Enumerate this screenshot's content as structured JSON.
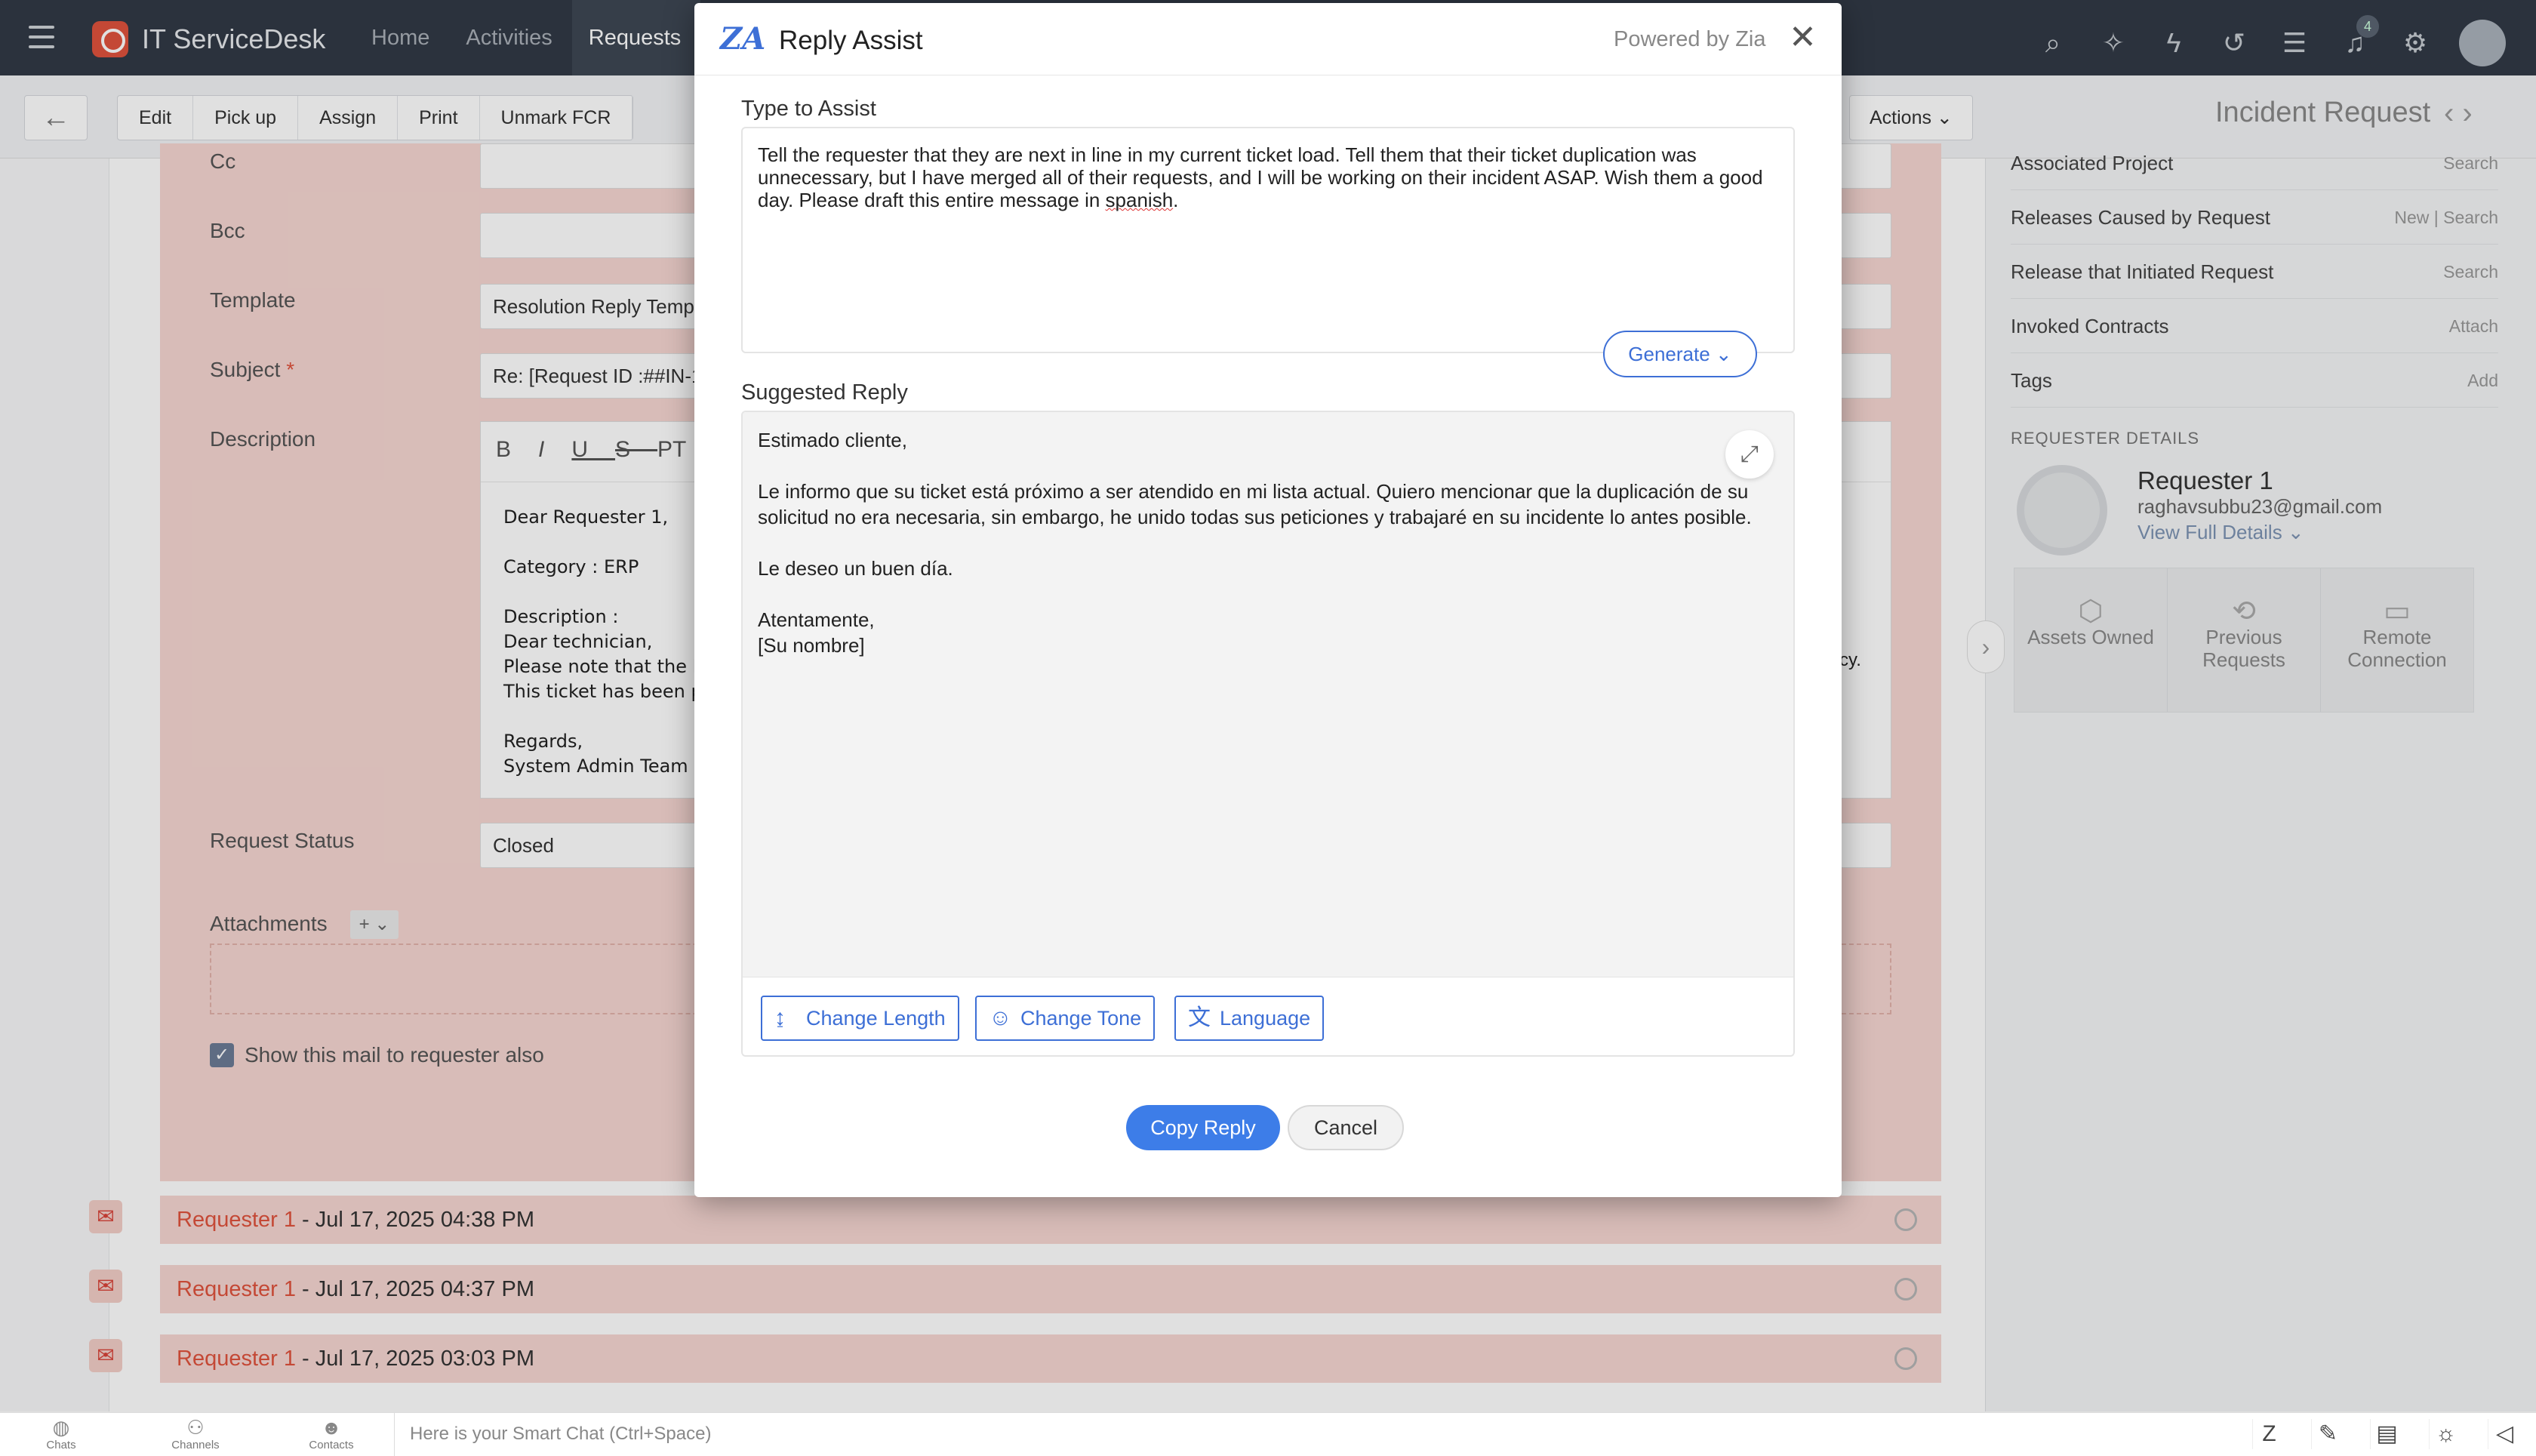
{
  "app": {
    "name": "IT ServiceDesk",
    "nav": [
      "Home",
      "Activities",
      "Requests"
    ],
    "notification_count": "4"
  },
  "toolbar": {
    "buttons": [
      "Edit",
      "Pick up",
      "Assign",
      "Print",
      "Unmark FCR"
    ],
    "actions_label": "Actions",
    "page_title": "Incident Request"
  },
  "form": {
    "cc_label": "Cc",
    "bcc_label": "Bcc",
    "template_label": "Template",
    "template_value": "Resolution Reply Template",
    "subject_label": "Subject",
    "subject_required": "*",
    "subject_value": "Re: [Request ID :##IN-1",
    "description_label": "Description",
    "description_text": "Dear Requester 1,\n\nCategory : ERP\n\nDescription :\nDear technician,\nPlease note that the Er\nThis ticket has been pr\n\nRegards,\nSystem Admin Team",
    "description_tail": "cy.",
    "request_status_label": "Request Status",
    "request_status_value": "Closed",
    "attachments_label": "Attachments",
    "attach_add": "+ ⌄",
    "show_mail_label": "Show this mail to requester also"
  },
  "threads": [
    {
      "name": "Requester 1",
      "date": " - Jul 17, 2025 04:38 PM"
    },
    {
      "name": "Requester 1",
      "date": " - Jul 17, 2025 04:37 PM"
    },
    {
      "name": "Requester 1",
      "date": " - Jul 17, 2025 03:03 PM"
    }
  ],
  "right_panel": {
    "rows": [
      {
        "label": "Associated Project",
        "action": "Search"
      },
      {
        "label": "Releases Caused by Request",
        "action": "New | Search"
      },
      {
        "label": "Release that Initiated Request",
        "action": "Search"
      },
      {
        "label": "Invoked Contracts",
        "action": "Attach"
      },
      {
        "label": "Tags",
        "action": "Add"
      }
    ],
    "requester_heading": "REQUESTER DETAILS",
    "requester_name": "Requester 1",
    "requester_email": "raghavsubbu23@gmail.com",
    "view_details": "View Full Details ⌄",
    "tiles": [
      "Assets Owned",
      "Previous Requests",
      "Remote Connection"
    ]
  },
  "modal": {
    "title": "Reply Assist",
    "powered_by": "Powered by Zia",
    "type_label": "Type to Assist",
    "prompt_before": "Tell the requester that they are next in line in my current ticket load. Tell them that their ticket duplication was unnecessary, but I have merged all of their requests, and I will be working on their incident ASAP. Wish them a good day. Please draft this entire message in ",
    "prompt_misspelled": "spanish",
    "prompt_after": ".",
    "generate_label": "Generate",
    "suggested_label": "Suggested Reply",
    "reply_greeting": "Estimado cliente,",
    "reply_body": "Le informo que su ticket está próximo a ser atendido en mi lista actual. Quiero mencionar que la duplicación de su solicitud no era necesaria, sin embargo, he unido todas sus peticiones y trabajaré en su incidente lo antes posible.",
    "reply_wish": "Le deseo un buen día.",
    "reply_closing": "Atentamente,",
    "reply_signature": "[Su nombre]",
    "change_length": "Change Length",
    "change_tone": "Change Tone",
    "language": "Language",
    "copy_reply": "Copy Reply",
    "cancel": "Cancel"
  },
  "bottom_bar": {
    "chats": "Chats",
    "channels": "Channels",
    "contacts": "Contacts",
    "smart_chat_placeholder": "Here is your Smart Chat (Ctrl+Space)"
  },
  "colors": {
    "topbar": "#313a46",
    "accent_blue": "#3d6fd6",
    "brand_red": "#e0533d",
    "form_bg": "#f6d7d2"
  }
}
